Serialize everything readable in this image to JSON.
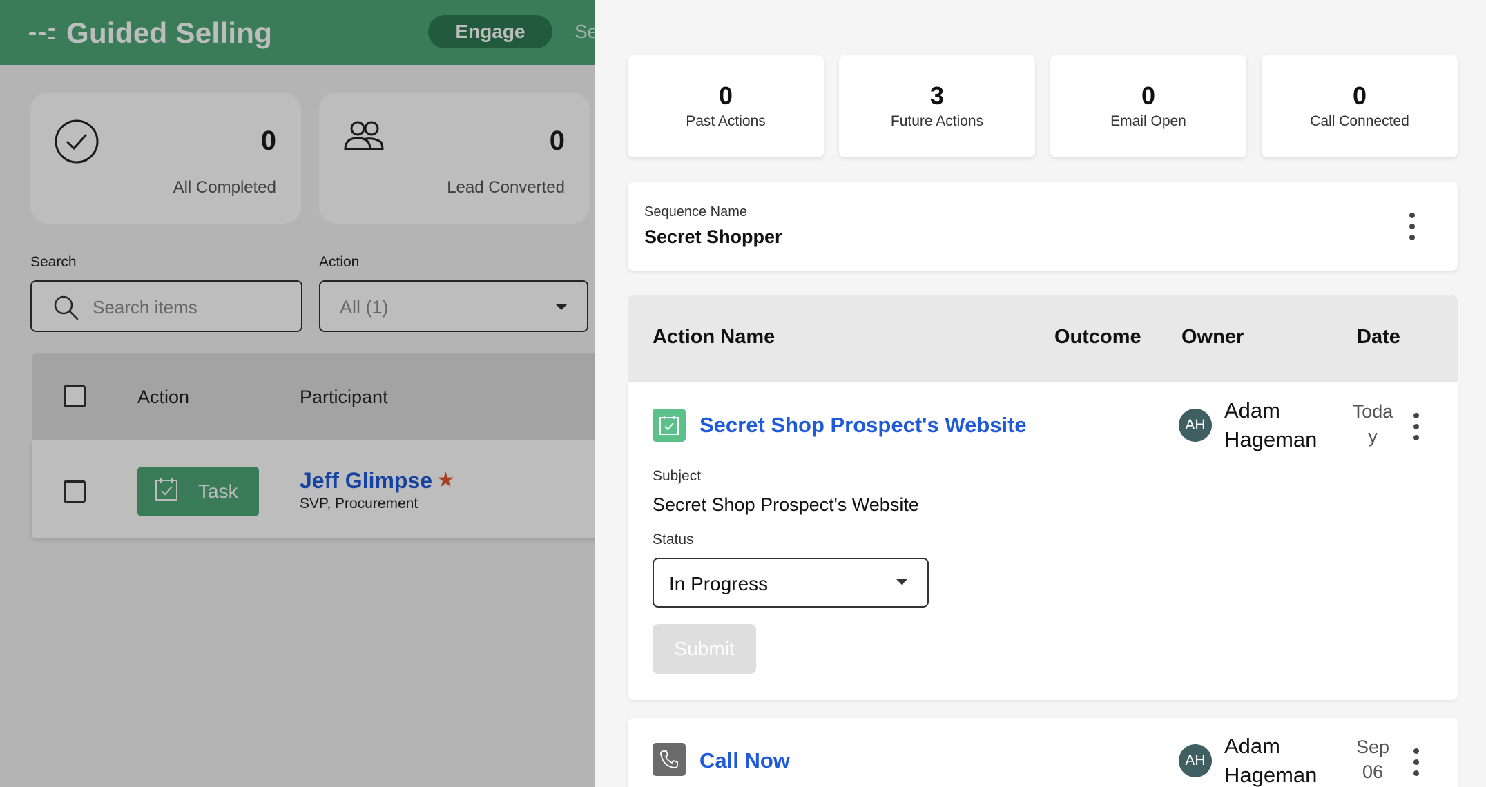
{
  "app": {
    "title": "Guided Selling",
    "nav_active": "Engage",
    "nav_next": "Se"
  },
  "stats": [
    {
      "value": "0",
      "label": "All Completed",
      "icon": "check-circle-icon"
    },
    {
      "value": "0",
      "label": "Lead Converted",
      "icon": "users-icon"
    }
  ],
  "filters": {
    "search_label": "Search",
    "search_placeholder": "Search items",
    "action_label": "Action",
    "action_value": "All (1)"
  },
  "list": {
    "headers": {
      "action": "Action",
      "participant": "Participant"
    },
    "rows": [
      {
        "action": "Task",
        "name": "Jeff Glimpse",
        "title": "SVP, Procurement"
      }
    ]
  },
  "drawer": {
    "metrics": [
      {
        "value": "0",
        "label": "Past Actions"
      },
      {
        "value": "3",
        "label": "Future Actions"
      },
      {
        "value": "0",
        "label": "Email Open"
      },
      {
        "value": "0",
        "label": "Call Connected"
      }
    ],
    "sequence": {
      "label": "Sequence Name",
      "name": "Secret Shopper"
    },
    "table_headers": {
      "action_name": "Action Name",
      "outcome": "Outcome",
      "owner": "Owner",
      "date": "Date"
    },
    "actions": [
      {
        "name": "Secret Shop Prospect's Website",
        "icon": "task-check-icon",
        "owner_initials": "AH",
        "owner_first": "Adam",
        "owner_last": "Hageman",
        "date_line1": "Toda",
        "date_line2": "y",
        "subject_label": "Subject",
        "subject": "Secret Shop Prospect's Website",
        "status_label": "Status",
        "status": "In Progress",
        "submit": "Submit"
      },
      {
        "name": "Call Now",
        "icon": "phone-icon",
        "owner_initials": "AH",
        "owner_first": "Adam",
        "owner_last": "Hageman",
        "date_line1": "Sep",
        "date_line2": "06"
      }
    ]
  },
  "colors": {
    "brand_green": "#4fa877",
    "nav_pill": "#2f7a53",
    "link_blue": "#1f5bd8",
    "avatar": "#3f5f63",
    "star": "#e05a2e"
  }
}
